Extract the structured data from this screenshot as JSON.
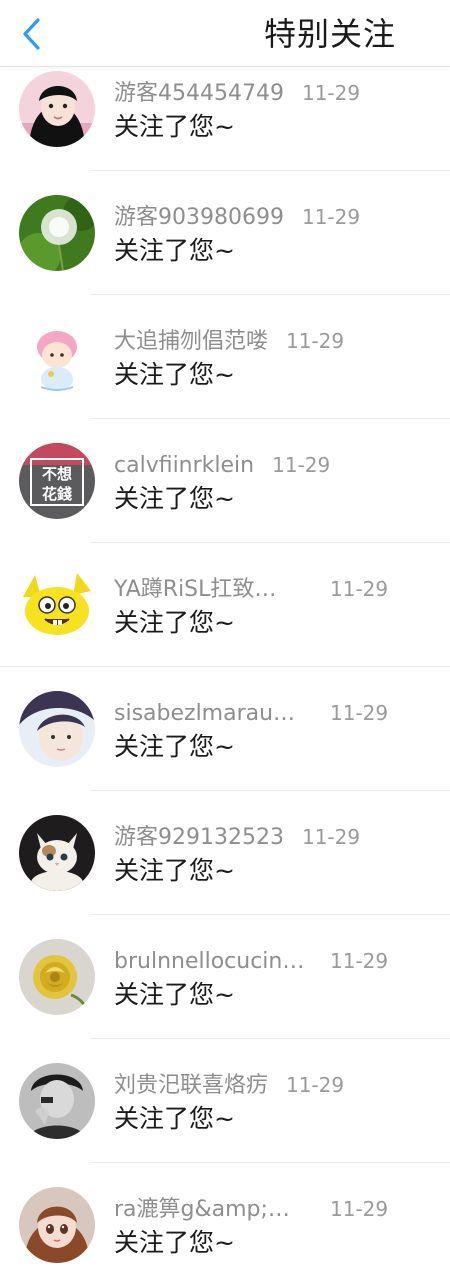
{
  "header": {
    "title": "特别关注",
    "back_icon": "chevron-left-icon",
    "accent_color": "#2c9cf0"
  },
  "notifications": [
    {
      "name": "游客454454749",
      "date": "11-29",
      "message": "关注了您~",
      "avatar": "girl-portrait-avatar"
    },
    {
      "name": "游客903980699",
      "date": "11-29",
      "message": "关注了您~",
      "avatar": "dandelion-avatar"
    },
    {
      "name": "大追捕刎倡范喽",
      "date": "11-29",
      "message": "关注了您~",
      "avatar": "cartoon-girl-avatar"
    },
    {
      "name": "calvfiinrklein",
      "date": "11-29",
      "message": "关注了您~",
      "avatar": "text-sign-avatar",
      "avatar_text_top": "不想",
      "avatar_text_bottom": "花錢"
    },
    {
      "name": "YA蹲RiSL扛致…",
      "date": "11-29",
      "message": "关注了您~",
      "avatar": "yellow-cartoon-avatar"
    },
    {
      "name": "sisabezlmarau…",
      "date": "11-29",
      "message": "关注了您~",
      "avatar": "girl-selfie-avatar"
    },
    {
      "name": "游客929132523",
      "date": "11-29",
      "message": "关注了您~",
      "avatar": "cat-avatar"
    },
    {
      "name": "brulnnellocucin…",
      "date": "11-29",
      "message": "关注了您~",
      "avatar": "yellow-rose-avatar"
    },
    {
      "name": "刘贵汜联喜烙疠",
      "date": "11-29",
      "message": "关注了您~",
      "avatar": "bw-portrait-avatar"
    },
    {
      "name": "ra漉箅g&amp;…",
      "date": "11-29",
      "message": "关注了您~",
      "avatar": "doll-avatar"
    }
  ]
}
